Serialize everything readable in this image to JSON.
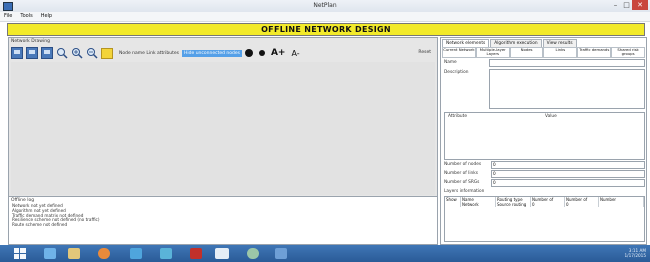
{
  "window": {
    "title": "NetPlan"
  },
  "menu": [
    "File",
    "Tools",
    "Help"
  ],
  "banner": "OFFLINE NETWORK DESIGN",
  "left": {
    "group_label": "Network Drawing",
    "toolbar_text": "Node name Link attributes",
    "toolbar_highlight": "Hide unconnected nodes",
    "font_up": "A+",
    "font_down": "A-",
    "reset": "Reset"
  },
  "log": {
    "group_label": "Offline log",
    "lines": [
      "Network not yet defined",
      "Algorithm not yet defined",
      "Traffic demand matrix not defined",
      "Resilience scheme not defined (no traffic)",
      "Route scheme not defined"
    ]
  },
  "right": {
    "top_tabs": [
      "Network elements",
      "Algorithm execution",
      "View results"
    ],
    "sub_tabs": [
      "Current Network",
      "Multiple-layer Layers",
      "Nodes",
      "Links",
      "Traffic demands",
      "Shared risk groups"
    ],
    "name_label": "Name",
    "description_label": "Description",
    "attribute_header": "Attribute",
    "value_header": "Value",
    "num_nodes_label": "Number of nodes",
    "num_links_label": "Number of links",
    "num_srgs_label": "Number of SRGs",
    "layers_label": "Layers information",
    "num_nodes_value": "0",
    "num_links_value": "0",
    "num_srgs_value": "0",
    "table_headers": [
      "Show",
      "Name",
      "Routing type",
      "Number of",
      "Number of",
      "Number"
    ],
    "table_row": [
      "",
      "Network",
      "Source routing",
      "0",
      "0",
      ""
    ]
  },
  "tray": {
    "time": "3:11 AM",
    "date": "1/17/2015"
  }
}
